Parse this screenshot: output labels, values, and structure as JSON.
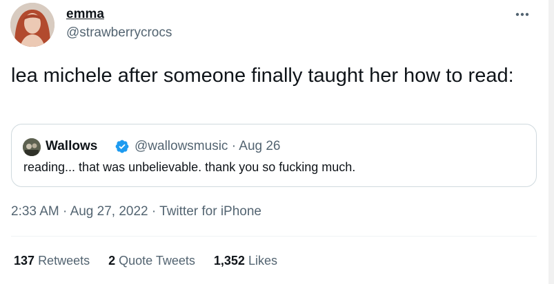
{
  "author": {
    "name": "emma",
    "handle": "@strawberrycrocs"
  },
  "tweet": {
    "text": "lea michele after someone finally taught her how to read:"
  },
  "quoted_tweet": {
    "name": "Wallows",
    "verified": true,
    "handle": "@wallowsmusic",
    "separator": "·",
    "date": "Aug 26",
    "text": "reading... that was unbelievable. thank you so fucking much."
  },
  "meta": {
    "time": "2:33 AM",
    "separator": "·",
    "date": "Aug 27, 2022",
    "source": "Twitter for iPhone"
  },
  "stats": [
    {
      "count": "137",
      "label": "Retweets"
    },
    {
      "count": "2",
      "label": "Quote Tweets"
    },
    {
      "count": "1,352",
      "label": "Likes"
    }
  ],
  "colors": {
    "text_primary": "#0f1419",
    "text_secondary": "#536471",
    "border": "#cfd9de",
    "verified_blue": "#1d9bf0"
  },
  "icons": {
    "more": "more-dots-icon",
    "verified": "verified-badge-icon"
  }
}
